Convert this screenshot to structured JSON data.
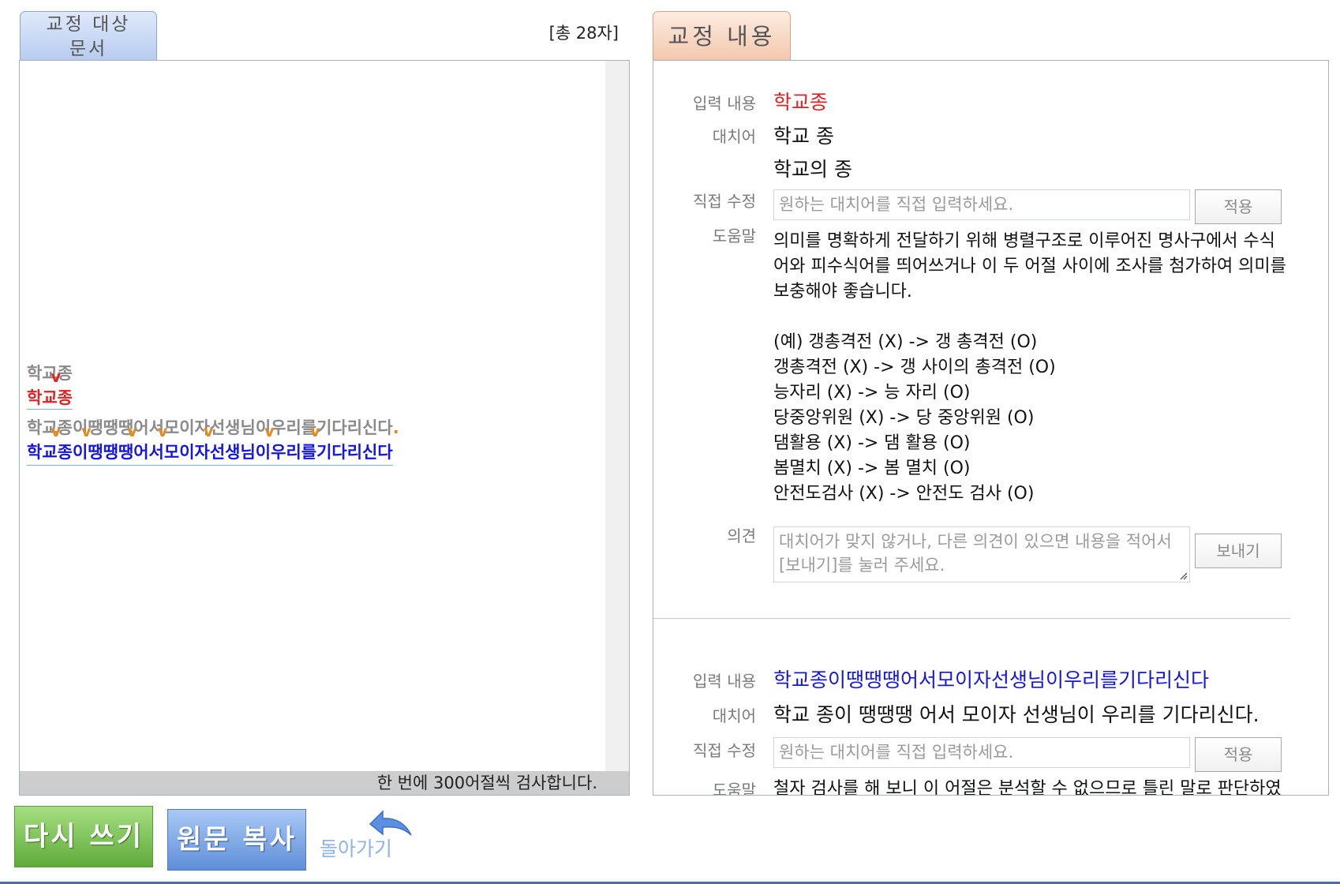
{
  "left": {
    "tab_label": "교정 대상\n문서",
    "char_count": "[총 28자]",
    "footer": "한 번에 300어절씩 검사합니다.",
    "lines": {
      "l1_orig": [
        "학교",
        "종"
      ],
      "l1_err": "학교종",
      "l2_orig": [
        "학교",
        "종이",
        "땡땡땡",
        "어서",
        "모이자",
        "선생님이",
        "우리를",
        "기다리신다"
      ],
      "l2_dot": ".",
      "l2_err": "학교종이땡땡땡어서모이자선생님이우리를기다리신다"
    }
  },
  "right": {
    "tab_label": "교정 내용",
    "labels": {
      "input": "입력 내용",
      "alternative": "대치어",
      "direct_edit": "직접 수정",
      "help": "도움말",
      "opinion": "의견"
    },
    "item1": {
      "input": "학교종",
      "alternatives": [
        "학교 종",
        "학교의 종"
      ],
      "edit_placeholder": "원하는 대치어를 직접 입력하세요.",
      "apply_button": "적용",
      "help_text": "의미를 명확하게 전달하기 위해 병렬구조로 이루어진 명사구에서 수식어와 피수식어를 띄어쓰거나 이 두 어절 사이에 조사를 첨가하여 의미를 보충해야 좋습니다.",
      "examples": [
        "(예) 갱총격전 (X) -> 갱 총격전 (O)",
        "갱총격전 (X) -> 갱 사이의 총격전 (O)",
        "능자리 (X) -> 능 자리 (O)",
        "당중앙위원 (X) -> 당 중앙위원 (O)",
        "댐활용 (X) -> 댐 활용 (O)",
        "봄멸치 (X) -> 봄 멸치 (O)",
        "안전도검사 (X) -> 안전도 검사 (O)"
      ],
      "opinion_placeholder": "대치어가 맞지 않거나, 다른 의견이 있으면 내용을 적어서 [보내기]를 눌러 주세요.",
      "send_button": "보내기"
    },
    "item2": {
      "input": "학교종이땡땡땡어서모이자선생님이우리를기다리신다",
      "alternative": "학교 종이 땡땡땡 어서 모이자 선생님이 우리를 기다리신다.",
      "edit_placeholder": "원하는 대치어를 직접 입력하세요.",
      "apply_button": "적용",
      "help_text": "철자 검사를 해 보니 이 어절은 분석할 수 없으므로 틀린 말로 판단하였"
    }
  },
  "bottom": {
    "rewrite_button": "다시 쓰기",
    "copy_button": "원문 복사",
    "back_label": "돌아가기"
  },
  "colors": {
    "error_red": "#e32020",
    "error_blue": "#1515e0",
    "marker_orange": "#e28a1e"
  }
}
